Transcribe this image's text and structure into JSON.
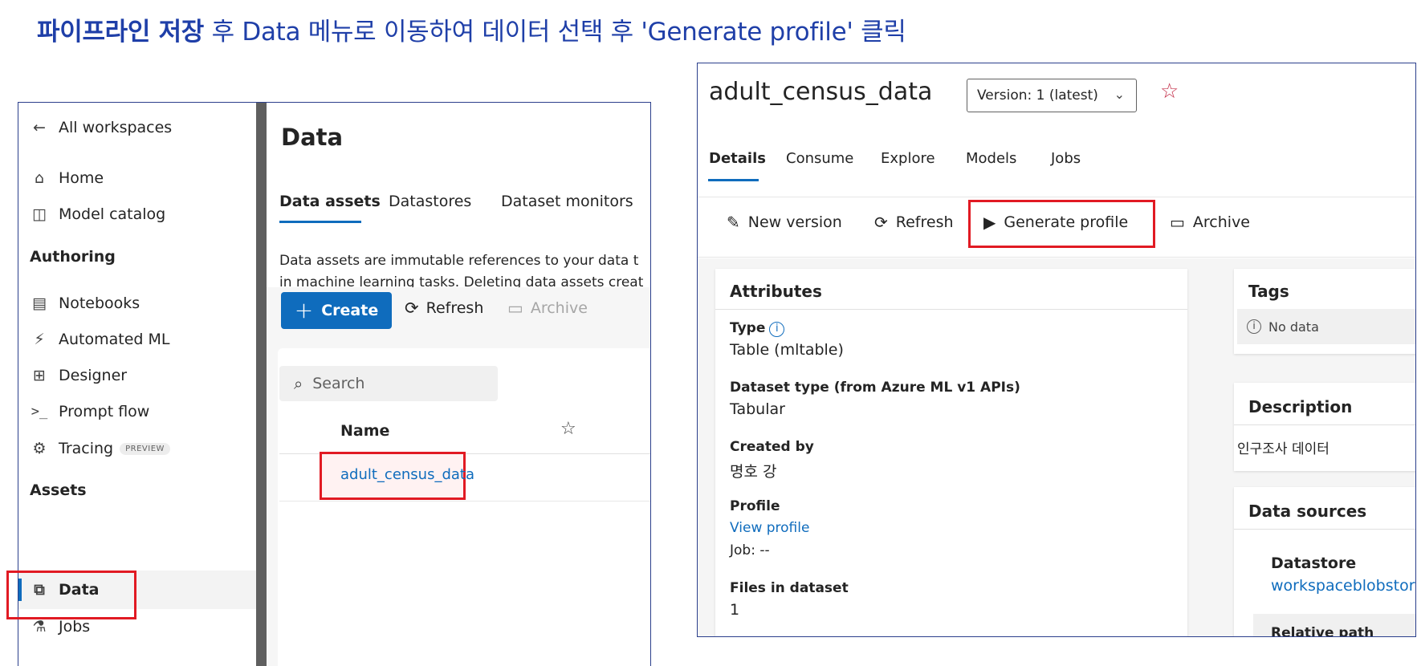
{
  "heading": {
    "bold": "파이프라인 저장",
    "rest": " 후 Data 메뉴로 이동하여 데이터 선택 후 'Generate profile' 클릭"
  },
  "sidebar": {
    "back_label": "All workspaces",
    "items_top": [
      {
        "label": "Home",
        "icon": "home-icon"
      },
      {
        "label": "Model catalog",
        "icon": "model-catalog-icon"
      }
    ],
    "section_authoring": "Authoring",
    "items_authoring": [
      {
        "label": "Notebooks",
        "icon": "notebook-icon"
      },
      {
        "label": "Automated ML",
        "icon": "automated-ml-icon"
      },
      {
        "label": "Designer",
        "icon": "designer-icon"
      },
      {
        "label": "Prompt flow",
        "icon": "prompt-flow-icon"
      },
      {
        "label": "Tracing",
        "icon": "tracing-icon",
        "badge": "PREVIEW"
      }
    ],
    "section_assets": "Assets",
    "items_assets": [
      {
        "label": "Data",
        "icon": "data-icon",
        "selected": true
      },
      {
        "label": "Jobs",
        "icon": "jobs-icon"
      }
    ]
  },
  "data_page": {
    "title": "Data",
    "tabs": [
      "Data assets",
      "Datastores",
      "Dataset monitors"
    ],
    "active_tab": "Data assets",
    "description_line1": "Data assets are immutable references to your data t",
    "description_line2": "in machine learning tasks. Deleting data assets creat",
    "toolbar": {
      "create": "Create",
      "refresh": "Refresh",
      "archive": "Archive"
    },
    "search_placeholder": "Search",
    "columns": {
      "name": "Name"
    },
    "rows": [
      {
        "name": "adult_census_data"
      }
    ]
  },
  "asset_page": {
    "title": "adult_census_data",
    "version_label": "Version: 1 (latest)",
    "tabs": [
      "Details",
      "Consume",
      "Explore",
      "Models",
      "Jobs"
    ],
    "active_tab": "Details",
    "toolbar": {
      "new_version": "New version",
      "refresh": "Refresh",
      "generate_profile": "Generate profile",
      "archive": "Archive"
    },
    "attributes": {
      "title": "Attributes",
      "type_label": "Type",
      "type_value": "Table (mltable)",
      "dataset_type_label": "Dataset type (from Azure ML v1 APIs)",
      "dataset_type_value": "Tabular",
      "created_by_label": "Created by",
      "created_by_value": "명호 강",
      "profile_label": "Profile",
      "profile_link": "View profile",
      "job_value": "Job: --",
      "files_label": "Files in dataset",
      "files_value": "1"
    },
    "tags": {
      "title": "Tags",
      "empty": "No data"
    },
    "description": {
      "title": "Description",
      "value": "인구조사 데이터"
    },
    "data_sources": {
      "title": "Data sources",
      "datastore_label": "Datastore",
      "datastore_value": "workspaceblobstor",
      "relative_path_label": "Relative path"
    }
  },
  "colors": {
    "accent": "#0f6cbd",
    "highlight": "#e11a23",
    "heading": "#1f3fa8"
  }
}
